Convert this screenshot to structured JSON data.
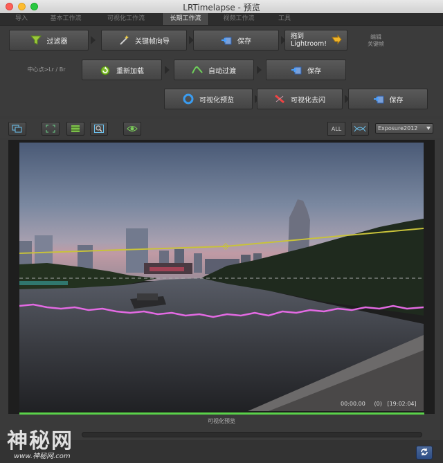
{
  "window": {
    "title": "LRTimelapse - 预览"
  },
  "tabs": [
    {
      "label": "导入"
    },
    {
      "label": "基本工作流"
    },
    {
      "label": "可视化工作流"
    },
    {
      "label": "长期工作流",
      "active": true
    },
    {
      "label": "视频工作流"
    },
    {
      "label": "工具"
    }
  ],
  "row1": {
    "filter": "过滤器",
    "keyframe_wizard": "关键帧向导",
    "save": "保存",
    "drag_lightroom": "拖到\nLightroom!",
    "edit_keyframes": "编辑\n关键帧"
  },
  "row2": {
    "center_note": "中心点>Lr / Br",
    "reload": "重新加载",
    "auto_transition": "自动过渡",
    "save": "保存"
  },
  "row3": {
    "visual_preview": "可视化预览",
    "visual_deflicker": "可视化去闪",
    "save": "保存"
  },
  "toolbar": {
    "all_label": "ALL",
    "process_version": "Exposure2012"
  },
  "viewer": {
    "timecode": "00:00.00     (0)   [19:02:04]",
    "caption": "可视化预览"
  },
  "watermark": {
    "logo_text": "神秘网",
    "url_text": "www.神秘网.com"
  },
  "colors": {
    "accent_green": "#5ad24a",
    "curve_yellow": "#c8c23a",
    "curve_magenta": "#e36ae3"
  }
}
